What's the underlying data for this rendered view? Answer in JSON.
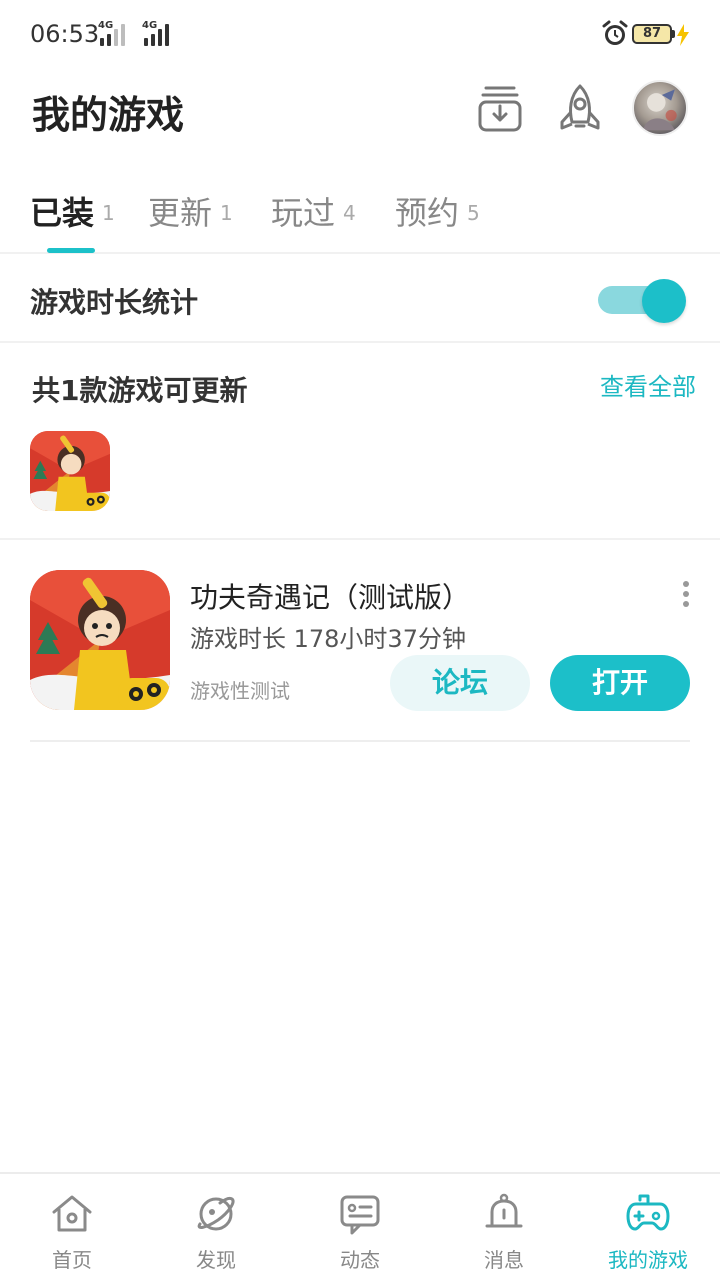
{
  "status_bar": {
    "time": "06:53",
    "network_1": "4G",
    "network_2": "4G",
    "battery": "87"
  },
  "header": {
    "title": "我的游戏",
    "icons": [
      "download-manager-icon",
      "rocket-icon",
      "avatar"
    ]
  },
  "tabs": [
    {
      "label": "已装",
      "count": "1",
      "active": true
    },
    {
      "label": "更新",
      "count": "1",
      "active": false
    },
    {
      "label": "玩过",
      "count": "4",
      "active": false
    },
    {
      "label": "预约",
      "count": "5",
      "active": false
    }
  ],
  "playtime_stats": {
    "label": "游戏时长统计",
    "enabled": true
  },
  "updates": {
    "title": "共1款游戏可更新",
    "view_all": "查看全部"
  },
  "game": {
    "name": "功夫奇遇记（测试版）",
    "playtime": "游戏时长 178小时37分钟",
    "tag": "游戏性测试",
    "forum_button": "论坛",
    "open_button": "打开"
  },
  "bottom_nav": [
    {
      "label": "首页",
      "icon": "home-icon",
      "active": false
    },
    {
      "label": "发现",
      "icon": "planet-icon",
      "active": false
    },
    {
      "label": "动态",
      "icon": "chat-icon",
      "active": false
    },
    {
      "label": "消息",
      "icon": "bell-icon",
      "active": false
    },
    {
      "label": "我的游戏",
      "icon": "gamepad-icon",
      "active": true
    }
  ],
  "colors": {
    "accent": "#1cbfc9",
    "accent_light": "#eaf7f8",
    "toggle_track": "#8ad8de"
  }
}
